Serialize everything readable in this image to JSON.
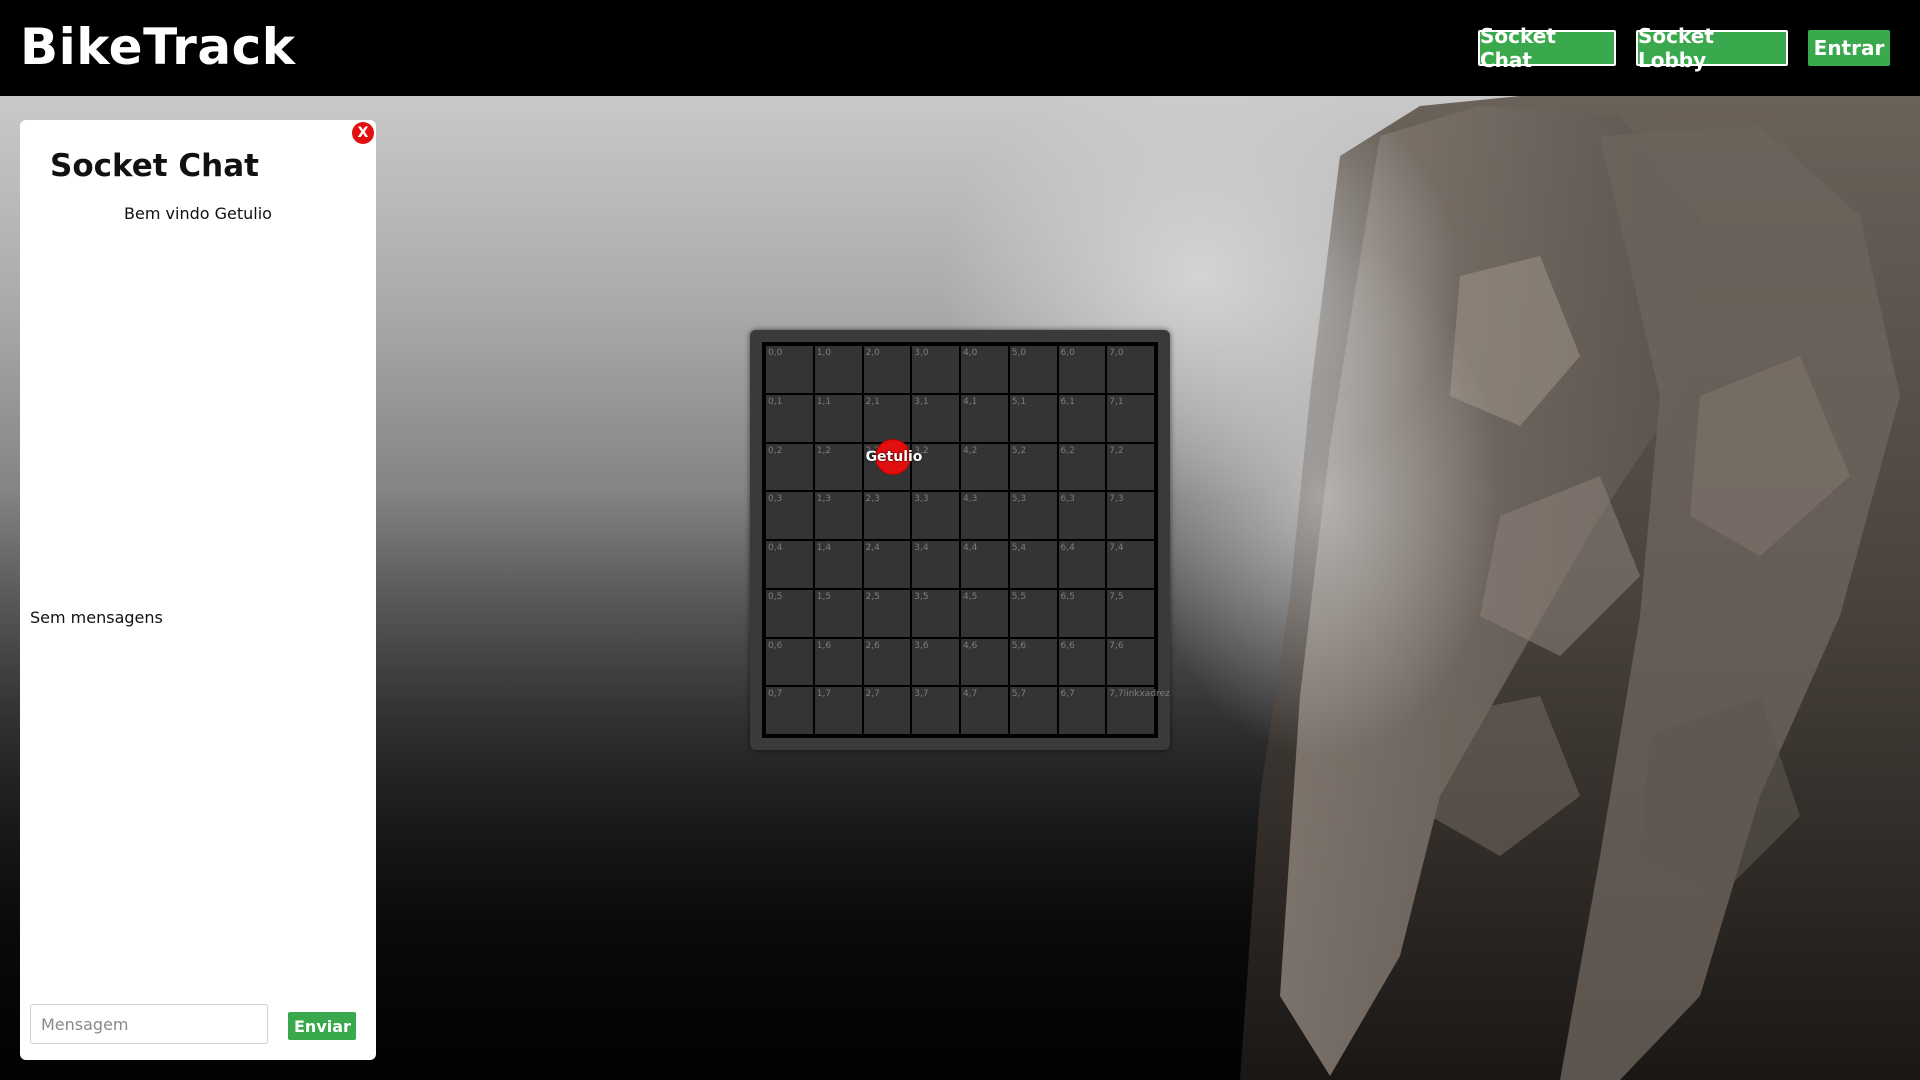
{
  "header": {
    "brand": "BikeTrack",
    "nav": [
      {
        "label": "Socket Chat"
      },
      {
        "label": "Socket Lobby"
      },
      {
        "label": "Entrar"
      }
    ]
  },
  "chat": {
    "close_label": "X",
    "title": "Socket Chat",
    "welcome": "Bem vindo Getulio",
    "empty_text": "Sem mensagens",
    "input_placeholder": "Mensagem",
    "input_value": "",
    "send_label": "Enviar"
  },
  "board": {
    "columns": 8,
    "rows": 8,
    "cell_labels": [
      [
        "0,0",
        "1,0",
        "2,0",
        "3,0",
        "4,0",
        "5,0",
        "6,0",
        "7,0"
      ],
      [
        "0,1",
        "1,1",
        "2,1",
        "3,1",
        "4,1",
        "5,1",
        "6,1",
        "7,1"
      ],
      [
        "0,2",
        "1,2",
        "2,2",
        "3,2",
        "4,2",
        "5,2",
        "6,2",
        "7,2"
      ],
      [
        "0,3",
        "1,3",
        "2,3",
        "3,3",
        "4,3",
        "5,3",
        "6,3",
        "7,3"
      ],
      [
        "0,4",
        "1,4",
        "2,4",
        "3,4",
        "4,4",
        "5,4",
        "6,4",
        "7,4"
      ],
      [
        "0,5",
        "1,5",
        "2,5",
        "3,5",
        "4,5",
        "5,5",
        "6,5",
        "7,5"
      ],
      [
        "0,6",
        "1,6",
        "2,6",
        "3,6",
        "4,6",
        "5,6",
        "6,6",
        "7,6"
      ],
      [
        "0,7",
        "1,7",
        "2,7",
        "3,7",
        "4,7",
        "5,7",
        "6,7",
        "7,7linkxadrez"
      ]
    ],
    "player": {
      "name": "Getulio",
      "cell": "2,2",
      "color": "#e10f0f"
    }
  },
  "colors": {
    "accent_green": "#3aa84c",
    "close_red": "#e10f0f",
    "header_bg": "#000000"
  }
}
